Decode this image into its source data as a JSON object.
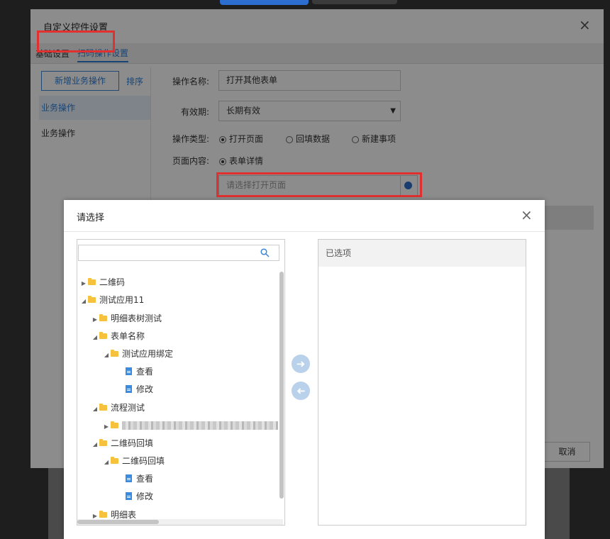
{
  "outer_dialog": {
    "title": "自定义控件设置",
    "tabs": [
      "基础设置",
      "扫码操作设置"
    ],
    "left": {
      "add_button": "新增业务操作",
      "sort_link": "排序",
      "items": [
        "业务操作",
        "业务操作"
      ]
    },
    "form": {
      "name_label": "操作名称:",
      "name_value": "打开其他表单",
      "validity_label": "有效期:",
      "validity_value": "长期有效",
      "type_label": "操作类型:",
      "type_options": [
        "打开页面",
        "回填数据",
        "新建事项"
      ],
      "type_selected": "打开页面",
      "content_label": "页面内容:",
      "content_option": "表单详情",
      "page_placeholder": "请选择打开页面"
    },
    "cancel_button": "取消"
  },
  "inner_dialog": {
    "title": "请选择",
    "search_placeholder": "",
    "tree": [
      {
        "label": "二维码",
        "type": "folder",
        "expanded": false
      },
      {
        "label": "测试应用11",
        "type": "folder",
        "expanded": true
      },
      {
        "label": "明细表树测试",
        "type": "folder",
        "expanded": false
      },
      {
        "label": "表单名称",
        "type": "folder",
        "expanded": true
      },
      {
        "label": "测试应用绑定",
        "type": "folder",
        "expanded": true
      },
      {
        "label": "查看",
        "type": "file"
      },
      {
        "label": "修改",
        "type": "file"
      },
      {
        "label": "流程测试",
        "type": "folder",
        "expanded": true
      },
      {
        "label": "",
        "type": "folder",
        "expanded": false
      },
      {
        "label": "二维码回填",
        "type": "folder",
        "expanded": true
      },
      {
        "label": "二维码回填",
        "type": "folder",
        "expanded": true
      },
      {
        "label": "查看",
        "type": "file"
      },
      {
        "label": "修改",
        "type": "file"
      },
      {
        "label": "明细表",
        "type": "folder",
        "expanded": false
      }
    ],
    "selected_header": "已选项",
    "icons": {
      "add": "arrow-right-icon",
      "remove": "arrow-left-icon",
      "search": "search-icon"
    }
  },
  "colors": {
    "accent": "#2f7fd6",
    "highlight": "#e03030",
    "folder": "#f6c23e"
  }
}
